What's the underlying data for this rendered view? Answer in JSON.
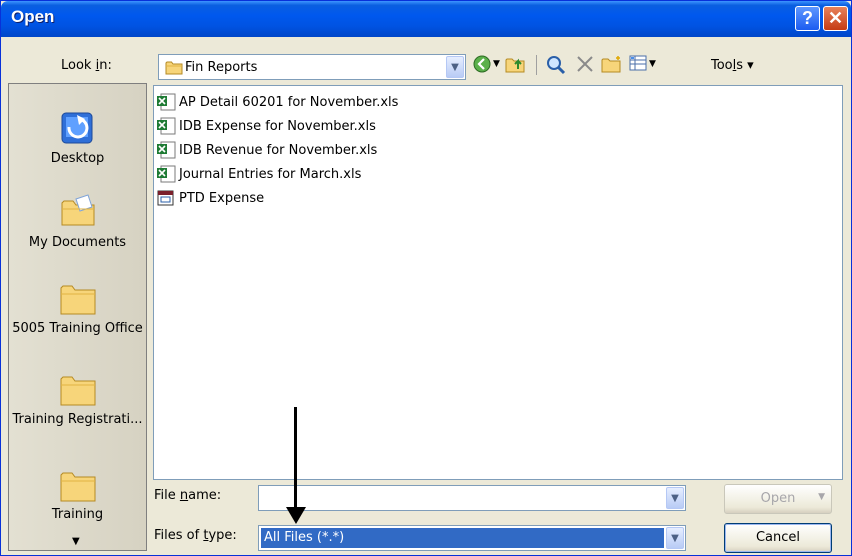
{
  "window": {
    "title": "Open"
  },
  "titlebar": {
    "help": "?",
    "close": "✕"
  },
  "lookin": {
    "label": "Look in:",
    "value": "Fin Reports"
  },
  "toolbar": {
    "tools_label": "Tools"
  },
  "places": [
    {
      "label": "Desktop"
    },
    {
      "label": "My Documents"
    },
    {
      "label": "5005 Training Office"
    },
    {
      "label": "Training Registrati..."
    },
    {
      "label": "Training"
    }
  ],
  "files": [
    {
      "name": "AP Detail 60201 for November.xls",
      "icon": "excel-icon"
    },
    {
      "name": "IDB Expense for November.xls",
      "icon": "excel-icon"
    },
    {
      "name": "IDB Revenue for November.xls",
      "icon": "excel-icon"
    },
    {
      "name": "Journal Entries for March.xls",
      "icon": "excel-icon"
    },
    {
      "name": "PTD Expense",
      "icon": "access-icon"
    }
  ],
  "filename": {
    "label": "File name:",
    "value": ""
  },
  "filetype": {
    "label": "Files of type:",
    "value": "All Files (*.*)"
  },
  "buttons": {
    "open": "Open",
    "cancel": "Cancel"
  },
  "colors": {
    "title_bar": "#0053e2",
    "selection": "#316ac5",
    "excel_green": "#1e7b34"
  }
}
